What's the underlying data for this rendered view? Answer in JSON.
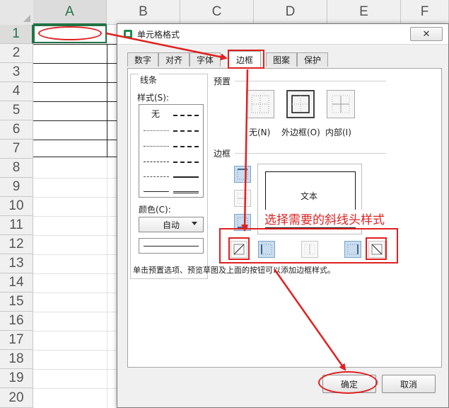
{
  "sheet": {
    "columns": [
      "A",
      "B",
      "C",
      "D",
      "E",
      "F"
    ],
    "rows": [
      "1",
      "2",
      "3",
      "4",
      "5",
      "6",
      "7",
      "8",
      "9",
      "10",
      "11",
      "12",
      "13",
      "14",
      "15",
      "16",
      "17",
      "18",
      "19",
      "20"
    ],
    "active_column": "A",
    "active_row": "1"
  },
  "dialog": {
    "title": "单元格格式",
    "close_symbol": "✕",
    "tabs": [
      {
        "label": "数字"
      },
      {
        "label": "对齐"
      },
      {
        "label": "字体"
      },
      {
        "label": "边框"
      },
      {
        "label": "图案"
      },
      {
        "label": "保护"
      }
    ],
    "active_tab": "边框",
    "line_group": {
      "title": "线条",
      "style_label": "样式(S):",
      "none_label": "无",
      "color_label": "颜色(C):",
      "color_value": "自动"
    },
    "preset": {
      "title": "预置",
      "none_label": "无(N)",
      "outline_label": "外边框(O)",
      "inside_label": "内部(I)"
    },
    "border": {
      "title": "边框",
      "preview_text": "文本"
    },
    "hint": "单击预置选项、预览草图及上面的按钮可以添加边框样式。",
    "ok_label": "确定",
    "cancel_label": "取消"
  },
  "annotation": {
    "text": "选择需要的斜线头样式",
    "color": "#e02020"
  },
  "colors": {
    "accent_green": "#217346",
    "annotation_red": "#e02020"
  }
}
